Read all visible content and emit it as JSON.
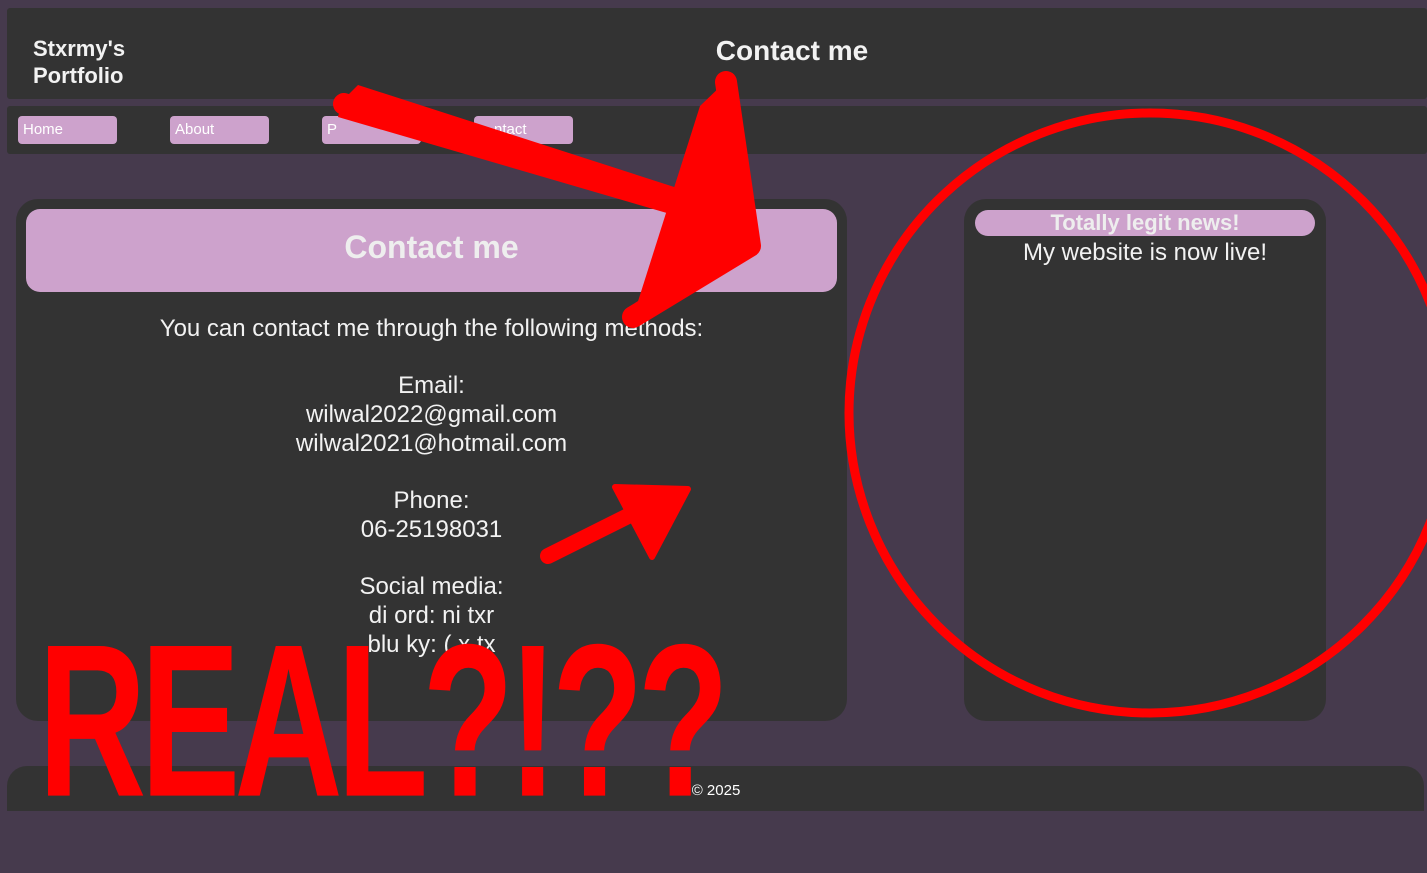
{
  "header": {
    "brand_line1": "Stxrmy's",
    "brand_line2": "Portfolio",
    "title": "Contact me"
  },
  "nav": {
    "items": [
      "Home",
      "About",
      "P",
      "ntact"
    ]
  },
  "contact_card": {
    "title": "Contact me",
    "intro": "You can contact me through the following methods:",
    "email_label": "Email:",
    "emails": [
      "wilwal2022@gmail.com",
      "wilwal2021@hotmail.com"
    ],
    "phone_label": "Phone:",
    "phone": "06-25198031",
    "social_label": "Social media:",
    "social_lines": [
      "di   ord: ni   txr",
      "blu   ky: (   x   tx   "
    ]
  },
  "news": {
    "title": "Totally legit news!",
    "items": [
      "My website is now live!"
    ]
  },
  "footer": {
    "copyright": "© 2025"
  },
  "overlay": {
    "caption": "REAL?!??",
    "arrow_count": 3,
    "circle": true,
    "color": "#ff0000"
  },
  "theme": {
    "background": "#463a4d",
    "panel": "#333333",
    "accent": "#cda2cc",
    "text": "#f2f2f2"
  }
}
